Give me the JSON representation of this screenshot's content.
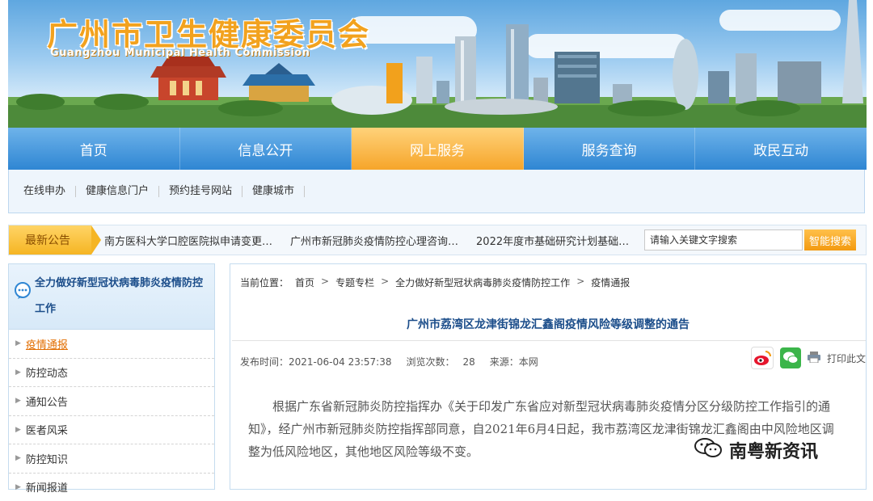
{
  "header": {
    "title": "广州市卫生健康委员会",
    "subtitle": "Guangzhou Municipal Health Commission"
  },
  "nav": {
    "items": [
      {
        "label": "首页"
      },
      {
        "label": "信息公开"
      },
      {
        "label": "网上服务",
        "active": true
      },
      {
        "label": "服务查询"
      },
      {
        "label": "政民互动"
      }
    ]
  },
  "subnav": {
    "items": [
      {
        "label": "在线申办"
      },
      {
        "label": "健康信息门户"
      },
      {
        "label": "预约挂号网站"
      },
      {
        "label": "健康城市"
      }
    ]
  },
  "announcements": {
    "label": "最新公告",
    "items": [
      {
        "text": "南方医科大学口腔医院拟申请变更…"
      },
      {
        "text": "广州市新冠肺炎疫情防控心理咨询…"
      },
      {
        "text": "2022年度市基础研究计划基础…"
      }
    ]
  },
  "search": {
    "placeholder": "请输入关键文字搜索",
    "button": "智能搜索"
  },
  "sidebar": {
    "title": "全力做好新型冠状病毒肺炎疫情防控工作",
    "items": [
      {
        "label": "疫情通报",
        "active": true
      },
      {
        "label": "防控动态"
      },
      {
        "label": "通知公告"
      },
      {
        "label": "医者风采"
      },
      {
        "label": "防控知识"
      },
      {
        "label": "新闻报道"
      }
    ]
  },
  "breadcrumb": {
    "prefix": "当前位置：",
    "items": [
      "首页",
      "专题专栏",
      "全力做好新型冠状病毒肺炎疫情防控工作",
      "疫情通报"
    ],
    "separator": ">"
  },
  "article": {
    "title": "广州市荔湾区龙津街锦龙汇鑫阁疫情风险等级调整的通告",
    "publish_label": "发布时间：",
    "publish_time": "2021-06-04 23:57:38",
    "views_label": "浏览次数：",
    "views": "28",
    "source_label": "来源：",
    "source": "本网",
    "print_label": "打印此文",
    "body": "根据广东省新冠肺炎防控指挥办《关于印发广东省应对新型冠状病毒肺炎疫情分区分级防控工作指引的通知》，经广州市新冠肺炎防控指挥部同意，自2021年6月4日起，我市荔湾区龙津街锦龙汇鑫阁由中风险地区调整为低风险地区，其他地区风险等级不变。"
  },
  "watermark": {
    "text": "南粤新资讯"
  },
  "colors": {
    "nav_blue": "#2f86d3",
    "nav_active": "#f6a52a",
    "title_blue": "#1b4d8a",
    "sidebar_active": "#e26d00"
  },
  "icons": {
    "sidebar_head": "speech-bubble-icon",
    "share": [
      "weibo-icon",
      "wechat-icon",
      "printer-icon"
    ]
  }
}
